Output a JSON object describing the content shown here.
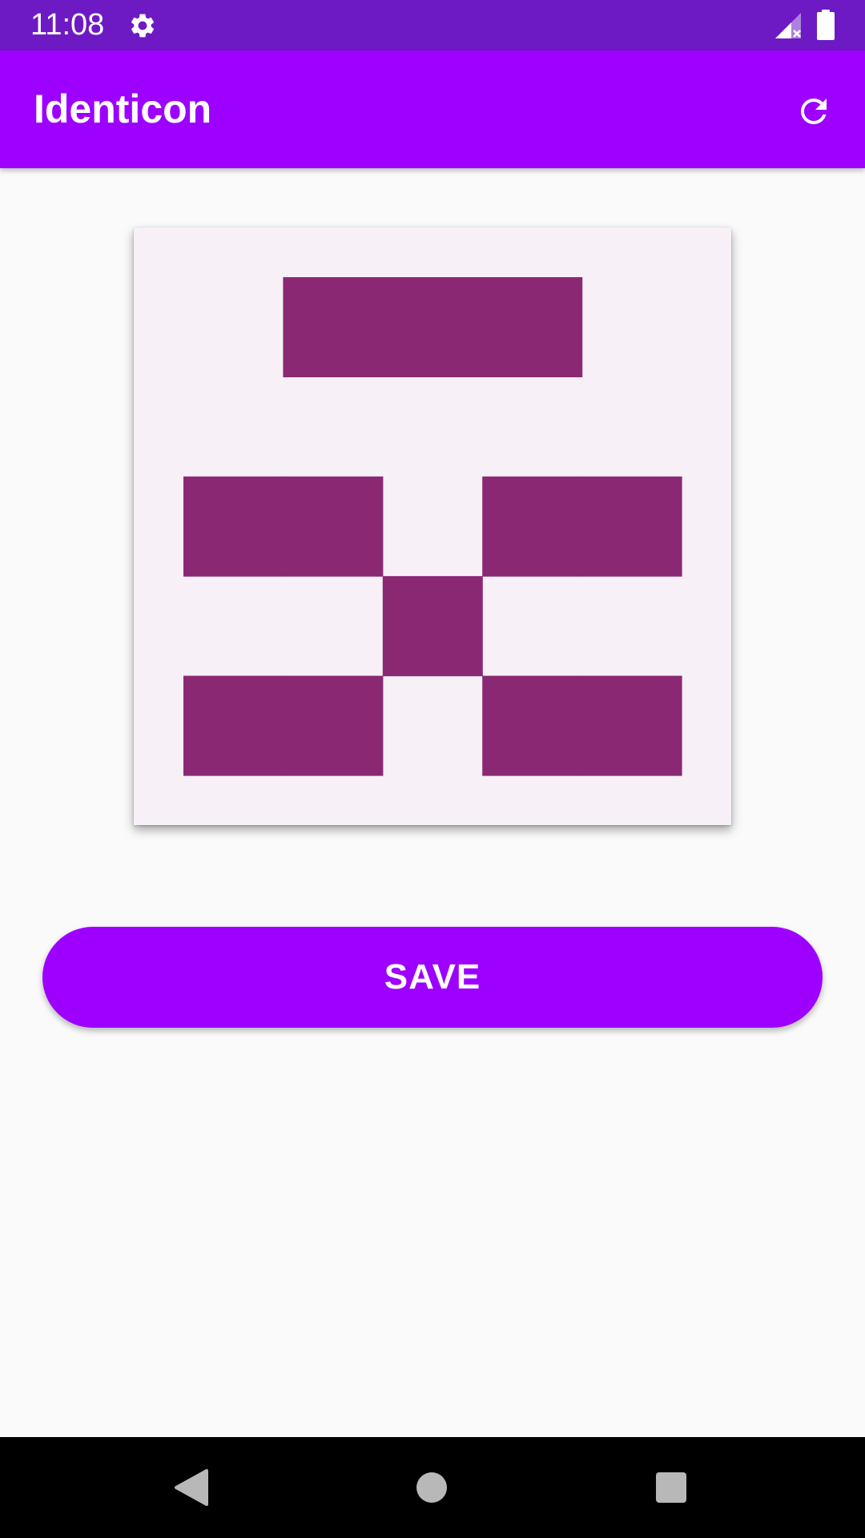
{
  "status_bar": {
    "time": "11:08",
    "icons": [
      "gear-icon",
      "signal-icon",
      "battery-icon"
    ],
    "background_color": "#6d1ac5"
  },
  "app_bar": {
    "title": "Identicon",
    "action_icon": "refresh-icon",
    "background_color": "#9e00ff"
  },
  "identicon": {
    "grid_size": 5,
    "color": "#8a2874",
    "background_color": "#f7f1f7",
    "cells_filled": [
      [
        0,
        0,
        0,
        0,
        0
      ],
      [
        0,
        1,
        1,
        1,
        0
      ],
      [
        0,
        0,
        0,
        0,
        0
      ],
      [
        1,
        1,
        0,
        1,
        1
      ],
      [
        0,
        0,
        1,
        0,
        0
      ],
      [
        1,
        1,
        0,
        1,
        1
      ]
    ]
  },
  "actions": {
    "save_label": "SAVE",
    "save_color": "#9e00ff"
  },
  "nav_bar": {
    "buttons": [
      "back-icon",
      "home-icon",
      "recents-icon"
    ]
  }
}
